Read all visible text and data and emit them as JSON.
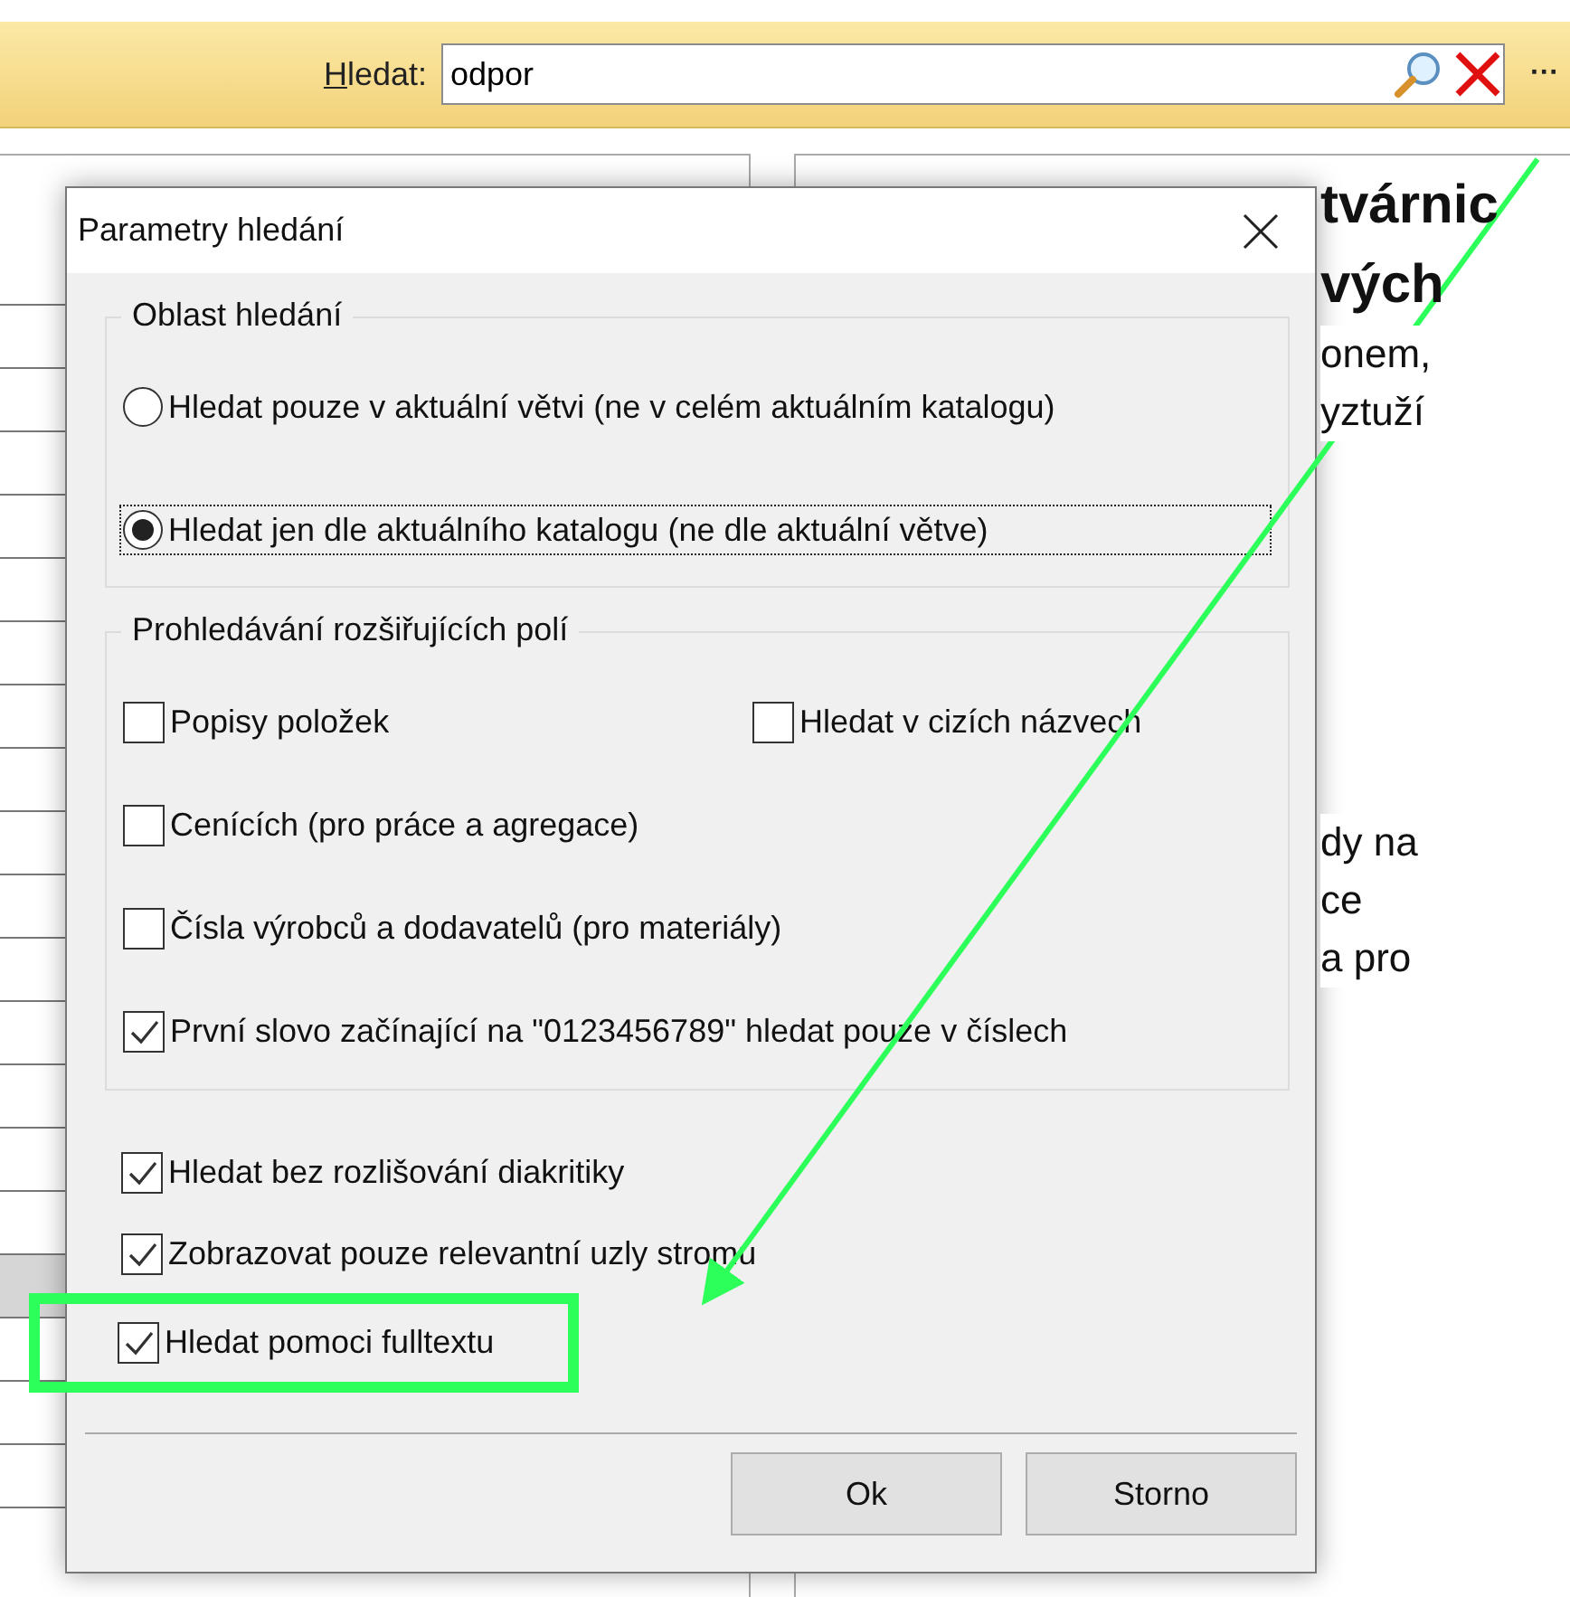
{
  "toolbar": {
    "search_label_mnemonic": "H",
    "search_label_rest": "ledat:",
    "search_value": "odpor",
    "more_button": "···"
  },
  "tree_rows": [
    {
      "selected": false
    },
    {
      "selected": false
    },
    {
      "selected": false
    },
    {
      "selected": false
    },
    {
      "selected": false
    },
    {
      "selected": false
    },
    {
      "selected": false
    },
    {
      "selected": false
    },
    {
      "selected": false
    },
    {
      "selected": false
    },
    {
      "selected": false
    },
    {
      "selected": false
    },
    {
      "selected": false
    },
    {
      "selected": false
    },
    {
      "selected": false
    },
    {
      "selected": false
    },
    {
      "selected": true
    },
    {
      "selected": false
    },
    {
      "selected": false
    },
    {
      "selected": false
    }
  ],
  "detail": {
    "heading_lines": [
      "tvárnic",
      "vých"
    ],
    "body_lines": [
      "onem,",
      "yztuží"
    ],
    "body_lines_2": [
      "dy na",
      "ce",
      "a pro"
    ]
  },
  "dialog": {
    "title": "Parametry hledání",
    "area_group": {
      "title": "Oblast hledání",
      "options": [
        {
          "label": "Hledat pouze v aktuální větvi (ne v celém aktuálním katalogu)",
          "selected": false,
          "focused": false
        },
        {
          "label": "Hledat jen dle aktuálního katalogu (ne dle aktuální větve)",
          "selected": true,
          "focused": true
        }
      ]
    },
    "fields_group": {
      "title": "Prohledávání rozšiřujících polí",
      "options": [
        {
          "label": "Popisy položek",
          "checked": false
        },
        {
          "label": "Hledat v cizích názvech",
          "checked": false
        },
        {
          "label": "Cenících (pro práce a agregace)",
          "checked": false
        },
        {
          "label": "Čísla výrobců a dodavatelů (pro materiály)",
          "checked": false
        },
        {
          "label": "První slovo začínající na \"0123456789\" hledat pouze v číslech",
          "checked": true
        }
      ]
    },
    "options": [
      {
        "label": "Hledat bez rozlišování diakritiky",
        "checked": true,
        "highlighted": false
      },
      {
        "label": "Zobrazovat pouze relevantní uzly stromu",
        "checked": true,
        "highlighted": false
      },
      {
        "label": "Hledat pomoci fulltextu",
        "checked": true,
        "highlighted": true
      }
    ],
    "buttons": [
      "Ok",
      "Storno"
    ]
  }
}
